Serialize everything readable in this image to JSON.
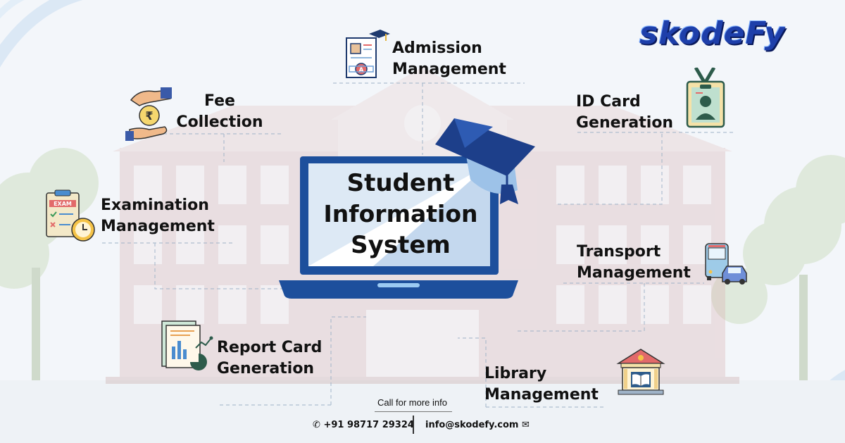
{
  "brand": {
    "logo_text": "skodeFy",
    "accent": "#1e3faa",
    "dark": "#0a1a5c"
  },
  "center": {
    "line1": "Student",
    "line2": "Information",
    "line3": "System"
  },
  "features": [
    {
      "id": "admission",
      "line1": "Admission",
      "line2": "Management",
      "icon": "admission-form-icon"
    },
    {
      "id": "fee",
      "line1": "Fee",
      "line2": "Collection",
      "icon": "rupee-hands-icon"
    },
    {
      "id": "idcard",
      "line1": "ID Card",
      "line2": "Generation",
      "icon": "id-card-icon"
    },
    {
      "id": "exam",
      "line1": "Examination",
      "line2": "Management",
      "icon": "exam-clipboard-icon"
    },
    {
      "id": "transport",
      "line1": "Transport",
      "line2": "Management",
      "icon": "bus-car-icon"
    },
    {
      "id": "report",
      "line1": "Report Card",
      "line2": "Generation",
      "icon": "report-chart-icon"
    },
    {
      "id": "library",
      "line1": "Library",
      "line2": "Management",
      "icon": "library-building-icon"
    }
  ],
  "contact": {
    "call_label": "Call for more info",
    "phone": "+91 98717 29324",
    "email": "info@skodefy.com"
  }
}
